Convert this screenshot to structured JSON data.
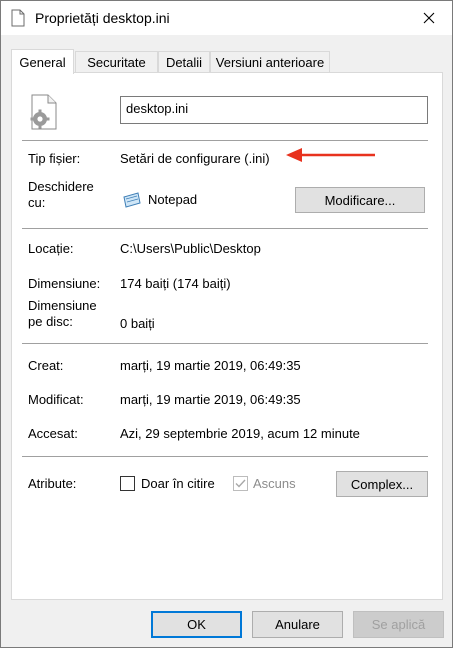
{
  "window": {
    "title": "Proprietăți desktop.ini",
    "close_icon": "close-icon"
  },
  "tabs": [
    {
      "label": "General",
      "active": true
    },
    {
      "label": "Securitate",
      "active": false
    },
    {
      "label": "Detalii",
      "active": false
    },
    {
      "label": "Versiuni anterioare",
      "active": false
    }
  ],
  "general": {
    "file_name": "desktop.ini",
    "file_type_label": "Tip fișier:",
    "file_type_value": "Setări de configurare (.ini)",
    "opens_with_label": "Deschidere cu:",
    "opens_with_label_line1": "Deschidere",
    "opens_with_label_line2": "cu:",
    "opens_with_app": "Notepad",
    "change_button": "Modificare...",
    "location_label": "Locație:",
    "location_value": "C:\\Users\\Public\\Desktop",
    "size_label": "Dimensiune:",
    "size_value": "174 baiți (174 baiți)",
    "size_on_disk_label_line1": "Dimensiune",
    "size_on_disk_label_line2": "pe disc:",
    "size_on_disk_value": "0 baiți",
    "created_label": "Creat:",
    "created_value": "marți, 19 martie 2019, 06:49:35",
    "modified_label": "Modificat:",
    "modified_value": "marți, 19 martie 2019, 06:49:35",
    "accessed_label": "Accesat:",
    "accessed_value": "Azi, 29 septembrie 2019, acum 12 minute",
    "attributes_label": "Atribute:",
    "readonly_label": "Doar în citire",
    "readonly_checked": false,
    "hidden_label": "Ascuns",
    "hidden_checked": true,
    "hidden_disabled": true,
    "advanced_button": "Complex..."
  },
  "footer": {
    "ok": "OK",
    "cancel": "Anulare",
    "apply": "Se aplică"
  },
  "colors": {
    "accent": "#0078d7",
    "annotation_arrow": "#e8321e"
  }
}
